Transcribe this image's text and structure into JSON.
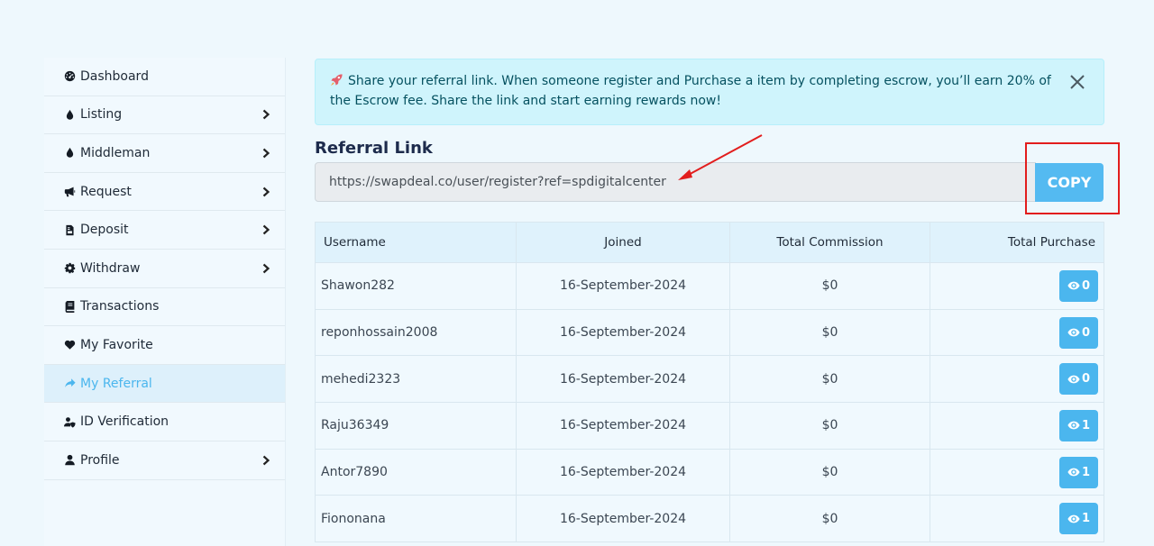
{
  "sidebar": {
    "items": [
      {
        "label": "Dashboard",
        "icon": "dashboard-icon",
        "chevron": false,
        "active": false
      },
      {
        "label": "Listing",
        "icon": "droplet-icon",
        "chevron": true,
        "active": false
      },
      {
        "label": "Middleman",
        "icon": "droplet-icon",
        "chevron": true,
        "active": false
      },
      {
        "label": "Request",
        "icon": "megaphone-icon",
        "chevron": true,
        "active": false
      },
      {
        "label": "Deposit",
        "icon": "file-invoice-icon",
        "chevron": true,
        "active": false
      },
      {
        "label": "Withdraw",
        "icon": "gear-icon",
        "chevron": true,
        "active": false
      },
      {
        "label": "Transactions",
        "icon": "book-icon",
        "chevron": false,
        "active": false
      },
      {
        "label": "My Favorite",
        "icon": "heart-icon",
        "chevron": false,
        "active": false
      },
      {
        "label": "My Referral",
        "icon": "share-icon",
        "chevron": false,
        "active": true
      },
      {
        "label": "ID Verification",
        "icon": "user-shield-icon",
        "chevron": false,
        "active": false
      },
      {
        "label": "Profile",
        "icon": "user-icon",
        "chevron": true,
        "active": false
      }
    ]
  },
  "alert": {
    "text": "Share your referral link. When someone register and Purchase a item by completing escrow, you’ll earn 20% of the Escrow fee. Share the link and start earning rewards now!"
  },
  "referral": {
    "title": "Referral Link",
    "link": "https://swapdeal.co/user/register?ref=spdigitalcenter",
    "copy_label": "COPY"
  },
  "table": {
    "headers": [
      "Username",
      "Joined",
      "Total Commission",
      "Total Purchase"
    ],
    "rows": [
      {
        "username": "Shawon282",
        "joined": "16-September-2024",
        "commission": "$0",
        "purchase": "0"
      },
      {
        "username": "reponhossain2008",
        "joined": "16-September-2024",
        "commission": "$0",
        "purchase": "0"
      },
      {
        "username": "mehedi2323",
        "joined": "16-September-2024",
        "commission": "$0",
        "purchase": "0"
      },
      {
        "username": "Raju36349",
        "joined": "16-September-2024",
        "commission": "$0",
        "purchase": "1"
      },
      {
        "username": "Antor7890",
        "joined": "16-September-2024",
        "commission": "$0",
        "purchase": "1"
      },
      {
        "username": "Fiononana",
        "joined": "16-September-2024",
        "commission": "$0",
        "purchase": "1"
      }
    ]
  },
  "colors": {
    "accent": "#4bb6ee",
    "alert_bg": "#cff4fc",
    "annotation_red": "#e21d1d"
  }
}
